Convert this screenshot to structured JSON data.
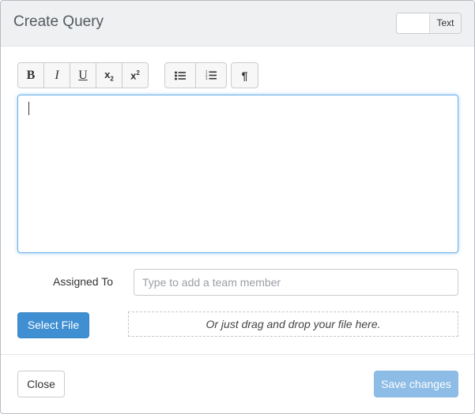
{
  "modal": {
    "title": "Create Query",
    "mode_toggle_label": "Text"
  },
  "toolbar": {
    "groups": [
      [
        {
          "name": "bold",
          "glyph": "B",
          "icon": "bold-icon"
        },
        {
          "name": "italic",
          "glyph": "I",
          "icon": "italic-icon"
        },
        {
          "name": "underline",
          "glyph": "U",
          "icon": "underline-icon"
        },
        {
          "name": "subscript",
          "glyph": "x",
          "sub": "2",
          "icon": "subscript-icon"
        },
        {
          "name": "superscript",
          "glyph": "x",
          "sup": "2",
          "icon": "superscript-icon"
        }
      ],
      [
        {
          "name": "bullet-list",
          "icon": "bullet-list-icon"
        },
        {
          "name": "numbered-list",
          "icon": "numbered-list-icon"
        }
      ],
      [
        {
          "name": "paragraph",
          "glyph": "¶",
          "icon": "paragraph-icon"
        }
      ]
    ]
  },
  "editor": {
    "value": ""
  },
  "assigned_to": {
    "label": "Assigned To",
    "placeholder": "Type to add a team member",
    "value": ""
  },
  "upload": {
    "select_label": "Select File",
    "dropzone_text": "Or just drag and drop your file here."
  },
  "footer": {
    "close_label": "Close",
    "save_label": "Save changes"
  },
  "colors": {
    "primary": "#3f8fd2",
    "primary_disabled": "#8dbce6",
    "focus_border": "#66afe9",
    "header_bg": "#eef0f2"
  }
}
